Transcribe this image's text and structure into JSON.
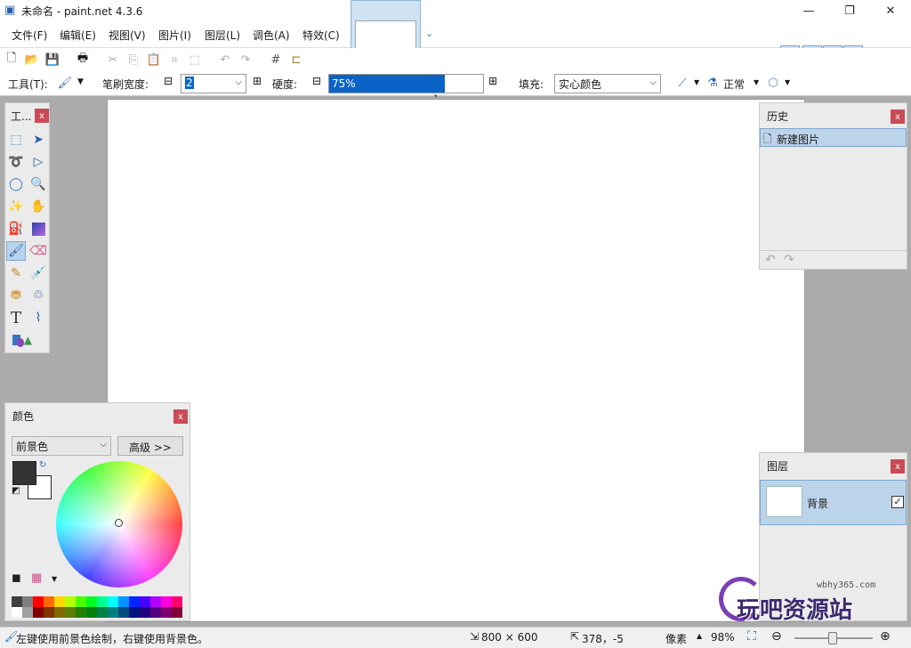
{
  "window": {
    "title": "未命名 - paint.net 4.3.6",
    "minimize": "—",
    "maximize": "❐",
    "close": "✕"
  },
  "menu": [
    "文件(F)",
    "编辑(E)",
    "视图(V)",
    "图片(I)",
    "图层(L)",
    "调色(A)",
    "特效(C)"
  ],
  "toolbar": {
    "tool_label": "工具(T):",
    "brush_width_label": "笔刷宽度:",
    "brush_width_value": "2",
    "hardness_label": "硬度:",
    "hardness_value": "75%",
    "hardness_level": 0.75,
    "fill_label": "填充:",
    "fill_value": "实心颜色",
    "blend_value": "正常"
  },
  "tools_panel": {
    "title": "工..."
  },
  "history_panel": {
    "title": "历史",
    "items": [
      "新建图片"
    ]
  },
  "colors_panel": {
    "title": "颜色",
    "mode_value": "前景色",
    "more_button": "高级 >>",
    "primary_color": "#333333",
    "secondary_color": "#ffffff",
    "palette_row1": [
      "#404040",
      "#7f7f7f",
      "#ff0000",
      "#ff6a00",
      "#ffd800",
      "#b6ff00",
      "#4cff00",
      "#00ff21",
      "#00ff90",
      "#00ffff",
      "#0094ff",
      "#0026ff",
      "#4800ff",
      "#b200ff",
      "#ff00dc",
      "#ff006e"
    ],
    "palette_row2": [
      "#ffffff",
      "#a0a0a0",
      "#7f0000",
      "#7f3300",
      "#7f6a00",
      "#5b7f00",
      "#267f00",
      "#007f0e",
      "#007f46",
      "#007f7f",
      "#004a7f",
      "#00137f",
      "#21007f",
      "#57007f",
      "#7f006e",
      "#7f0037"
    ]
  },
  "layers_panel": {
    "title": "图层",
    "items": [
      {
        "name": "背景",
        "checked": true
      }
    ]
  },
  "status": {
    "hint": "左键使用前景色绘制，右键使用背景色。",
    "image_size": "800 × 600",
    "cursor_pos": "378，-5",
    "unit": "像素",
    "zoom": "98%"
  },
  "watermark": {
    "site": "wbhy365.com",
    "brand": "玩吧资源站"
  }
}
